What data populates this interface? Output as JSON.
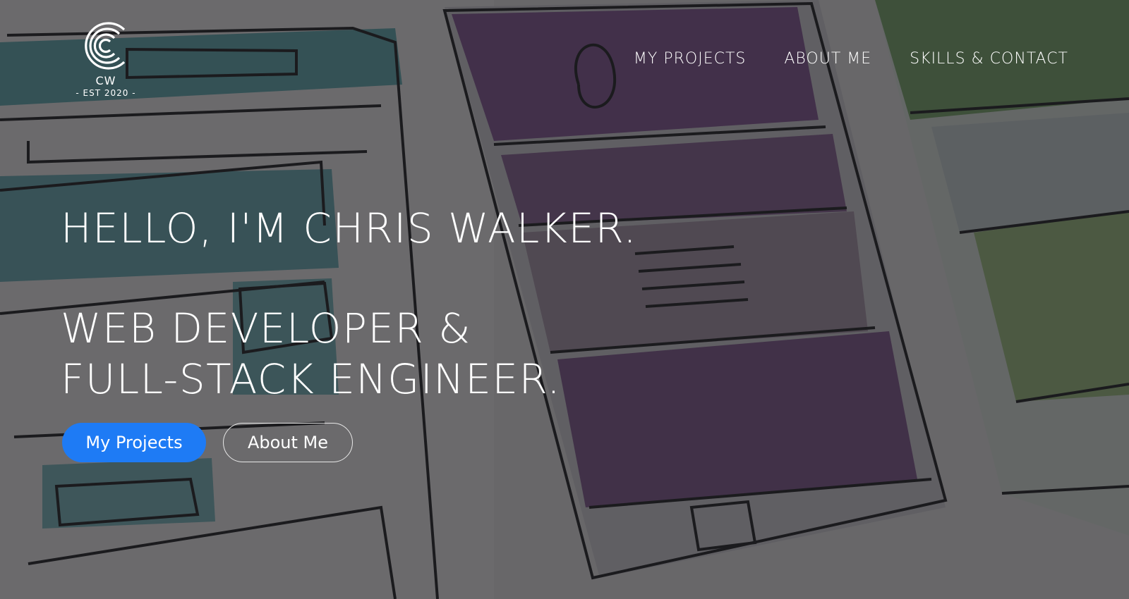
{
  "logo": {
    "initials": "CW",
    "est": "- EST 2020 -"
  },
  "nav": {
    "items": [
      {
        "label": "MY PROJECTS"
      },
      {
        "label": "ABOUT ME"
      },
      {
        "label": "SKILLS & CONTACT"
      }
    ]
  },
  "hero": {
    "greeting": "HELLO, I'M CHRIS WALKER.",
    "role_line1": "WEB DEVELOPER &",
    "role_line2": "FULL-STACK ENGINEER.",
    "primary_button": "My Projects",
    "secondary_button": "About Me"
  },
  "colors": {
    "primary_button_bg": "#1e7bf5",
    "text": "#ffffff",
    "overlay": "#1e1e22"
  }
}
